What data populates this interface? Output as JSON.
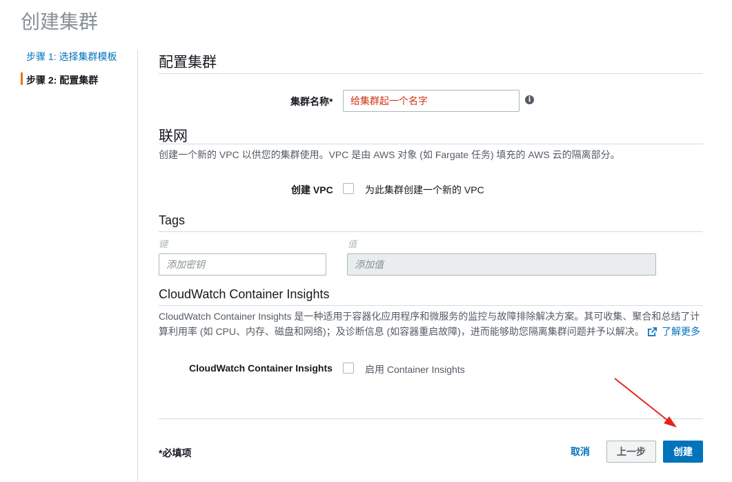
{
  "page_title": "创建集群",
  "sidebar": {
    "step1": "步骤 1: 选择集群模板",
    "step2": "步骤 2: 配置集群"
  },
  "configure": {
    "heading": "配置集群",
    "cluster_name_label": "集群名称*",
    "cluster_name_value": "给集群起一个名字"
  },
  "networking": {
    "heading": "联网",
    "description": "创建一个新的 VPC 以供您的集群使用。VPC 是由 AWS 对象 (如 Fargate 任务) 填充的 AWS 云的隔离部分。",
    "create_vpc_label": "创建 VPC",
    "create_vpc_checkbox_label": "为此集群创建一个新的 VPC"
  },
  "tags": {
    "heading": "Tags",
    "key_header": "键",
    "value_header": "值",
    "key_placeholder": "添加密钥",
    "value_placeholder": "添加值"
  },
  "insights": {
    "heading": "CloudWatch Container Insights",
    "description_line1": "CloudWatch Container Insights 是一种适用于容器化应用程序和微服务的监控与故障排除解决方案。其可收集、聚合和总结了计",
    "description_line2": "算利用率 (如 CPU、内存、磁盘和网络)；及诊断信息 (如容器重启故障)，进而能够助您隔离集群问题并予以解决。",
    "learn_more": "了解更多",
    "label": "CloudWatch Container Insights",
    "checkbox_label": "启用 Container Insights"
  },
  "footer": {
    "required_note": "*必填项",
    "cancel": "取消",
    "previous": "上一步",
    "create": "创建"
  },
  "colors": {
    "accent": "#0073bb",
    "active_step_bar": "#ec7211",
    "annotation_arrow": "#e8221b",
    "input_text": "#d13212"
  }
}
